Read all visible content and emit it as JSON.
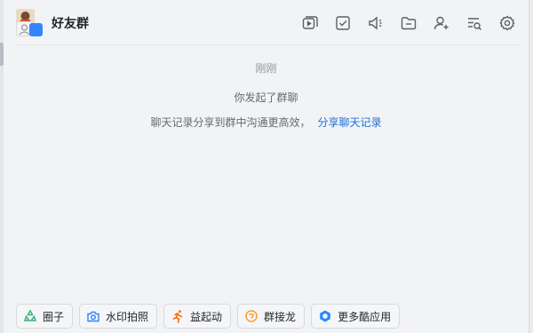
{
  "header": {
    "group_name": "好友群",
    "avatar": "group-avatar",
    "icons": [
      "video-icon",
      "task-check-icon",
      "announcement-icon",
      "folder-icon",
      "add-member-icon",
      "search-history-icon",
      "settings-gear-icon"
    ]
  },
  "chat": {
    "time": "刚刚",
    "system_message": "你发起了群聊",
    "share_text": "聊天记录分享到群中沟通更高效，",
    "share_link": "分享聊天记录"
  },
  "apps": [
    {
      "label": "圈子",
      "icon": "circle-icon",
      "color": "#36b37e"
    },
    {
      "label": "水印拍照",
      "icon": "camera-icon",
      "color": "#2f86ff"
    },
    {
      "label": "益起动",
      "icon": "runner-icon",
      "color": "#ff6a00"
    },
    {
      "label": "群接龙",
      "icon": "dragon-icon",
      "color": "#ff9a2e"
    },
    {
      "label": "更多酷应用",
      "icon": "more-apps-icon",
      "color": "#2f86ff"
    }
  ],
  "colors": {
    "link": "#1e6fd9",
    "background": "#f2f3f5"
  }
}
